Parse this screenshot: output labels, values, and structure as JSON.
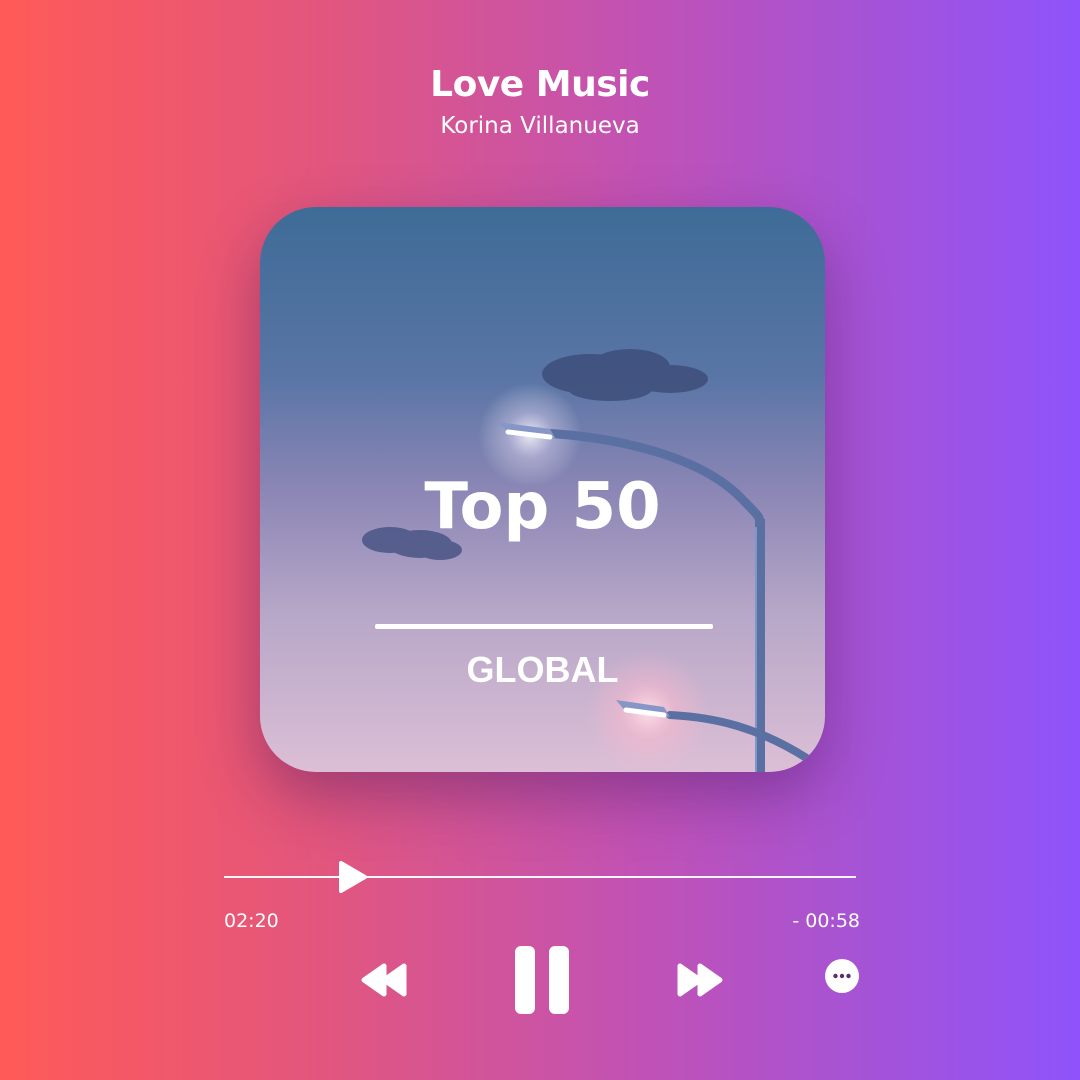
{
  "player": {
    "title": "Love Music",
    "artist": "Korina Villanueva"
  },
  "cover": {
    "title": "Top 50",
    "subtitle": "GLOBAL",
    "image": "street-lamps-and-clouds-at-dusk"
  },
  "progress": {
    "elapsed": "02:20",
    "remaining": "- 00:58",
    "fraction": 0.2
  },
  "controls": {
    "rewind_icon": "rewind-icon",
    "pause_icon": "pause-icon",
    "forward_icon": "fast-forward-icon",
    "more_icon": "more-options-icon"
  },
  "colors": {
    "gradient_start": "#ff5a57",
    "gradient_end": "#8f53fb",
    "foreground": "#ffffff"
  }
}
